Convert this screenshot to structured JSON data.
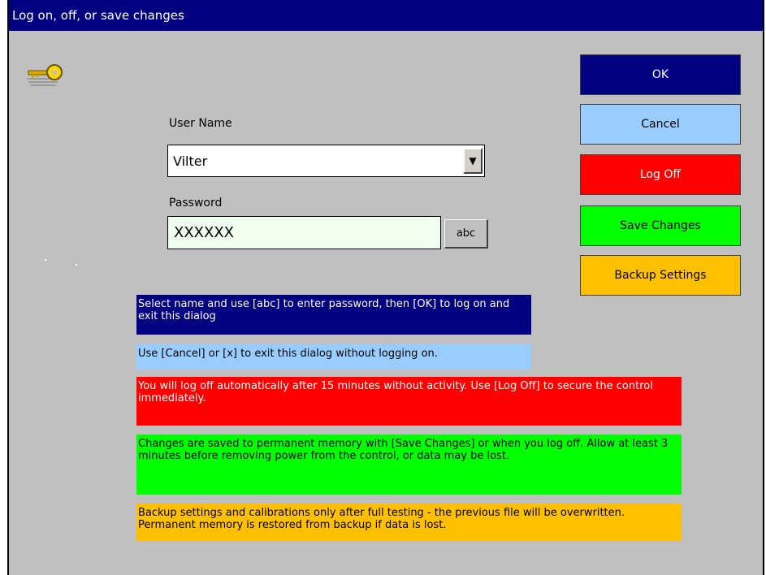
{
  "window": {
    "title": "Log on, off, or save changes"
  },
  "form": {
    "username_label": "User Name",
    "username_value": "Vilter",
    "dropdown_glyph": "▼",
    "password_label": "Password",
    "password_value": "XXXXXX",
    "abc_label": "abc"
  },
  "buttons": {
    "ok": "OK",
    "cancel": "Cancel",
    "logoff": "Log Off",
    "save": "Save Changes",
    "backup": "Backup Settings"
  },
  "notes": {
    "select": "Select name and use [abc] to enter password, then [OK] to log on and exit this dialog",
    "cancel": "Use [Cancel] or [x] to exit this dialog without logging on.",
    "logoff": "You will log off automatically after 15 minutes without activity. Use [Log Off] to secure the control immediately.",
    "save": "Changes are saved to permanent memory with [Save Changes] or when you log off. Allow at least 3 minutes before removing power from the control, or data may be lost.",
    "backup": "Backup settings and calibrations only after full testing - the previous file will be overwritten. Permanent memory is restored from backup if data is lost."
  },
  "icons": {
    "key": "key-icon"
  },
  "colors": {
    "title_bar": "#000080",
    "ok": "#000080",
    "cancel": "#99ccff",
    "logoff": "#ff0000",
    "save": "#00ff00",
    "backup": "#ffc000",
    "window_bg": "#c0c0c0"
  }
}
